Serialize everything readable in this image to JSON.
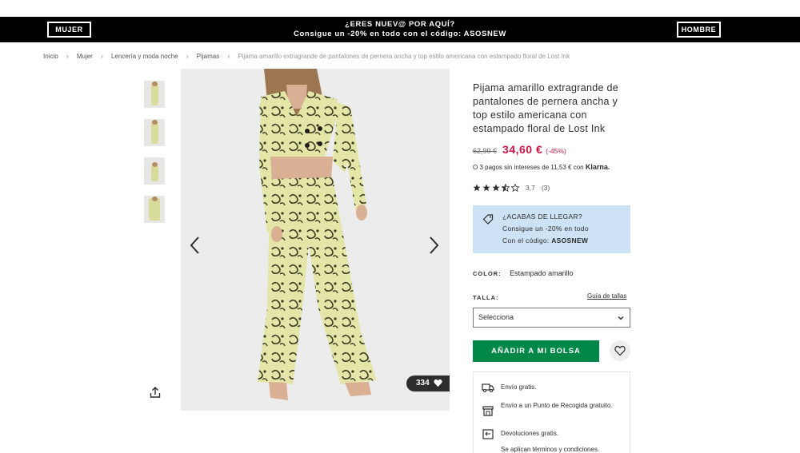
{
  "promo_bar": {
    "left_button": "MUJER",
    "right_button": "HOMBRE",
    "line1": "¿ERES NUEV@ POR AQUÍ?",
    "line2": "Consigue un -20% en todo con el código: ASOSNEW"
  },
  "breadcrumb": {
    "items": [
      "Inicio",
      "Mujer",
      "Lencería y moda noche",
      "Pijamas"
    ],
    "separator": "›",
    "current": "Pijama amarillo extragrande de pantalones de pernera ancha y top estilo americana con estampado floral de Lost Ink"
  },
  "gallery": {
    "favorites_count": "334"
  },
  "product": {
    "title": "Pijama amarillo extragrande de pantalones de pernera ancha y top estilo americana con estampado floral de Lost Ink",
    "old_price": "62,99 €",
    "price": "34,60 €",
    "discount": "(-45%)",
    "klarna_text": "O 3 pagos sin intereses de 11,53 € con",
    "klarna_brand": "Klarna.",
    "rating_value": "3,7",
    "rating_count": "(3)",
    "rating_stars": 3.5
  },
  "promo_box": {
    "line1": "¿ACABAS DE LLEGAR?",
    "line2": "Consigue un -20% en todo",
    "line3_prefix": "Con el código:",
    "line3_code": "ASOSNEW"
  },
  "color": {
    "label": "COLOR:",
    "value": "Estampado amarillo"
  },
  "size": {
    "label": "TALLA:",
    "guide": "Guía de tallas",
    "selected": "Selecciona"
  },
  "actions": {
    "add_to_bag": "AÑADIR A MI BOLSA"
  },
  "delivery": {
    "line1": "Envío gratis.",
    "line2": "Envío a un Punto de Recogida gratuito.",
    "line3": "Devoluciones gratis.",
    "line4": "Se aplican términos y condiciones."
  },
  "colors": {
    "promo_bg": "#000000",
    "price_red": "#d01345",
    "add_green": "#018849",
    "promo_box_bg": "#cde2f5"
  }
}
